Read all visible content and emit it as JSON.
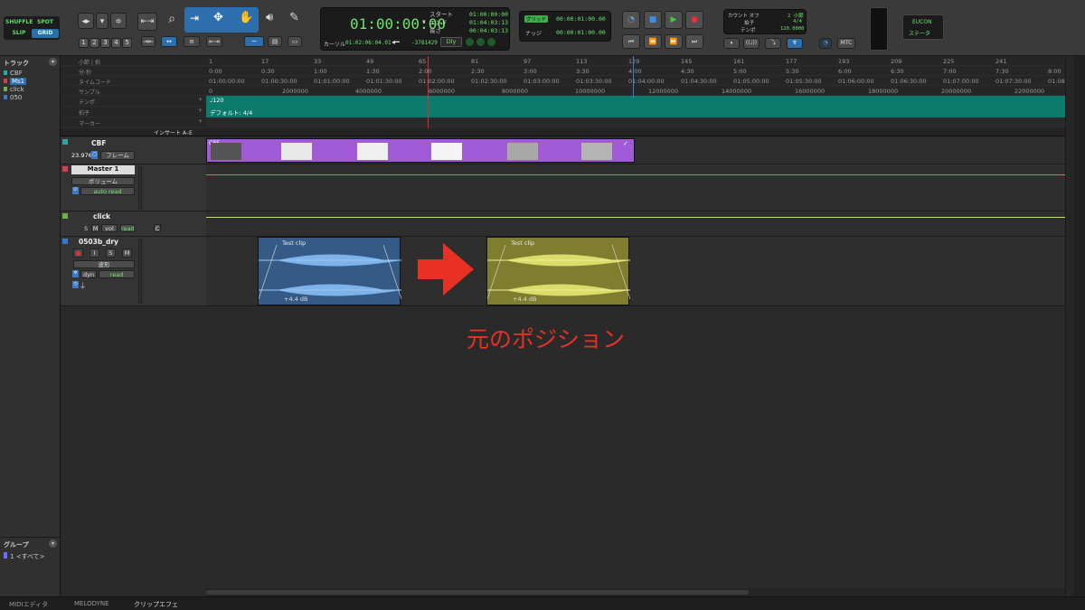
{
  "modes": {
    "shuffle": "SHUFFLE",
    "spot": "SPOT",
    "slip": "SLIP",
    "grid": "GRID"
  },
  "zoom_presets": [
    "1",
    "2",
    "3",
    "4",
    "5"
  ],
  "counter": {
    "main": "01:00:00:00",
    "start_label": "スタート",
    "end_label": "エンド",
    "length_label": "長さ",
    "start": "01:00:00:00",
    "end": "01:04:03:13",
    "length": "00:04:03:13",
    "cursor_label": "カーソル",
    "cursor": "01:02:06:04.01",
    "sample_offset": "-3781429",
    "dly": "Dly"
  },
  "grid": {
    "grid_label": "グリッド",
    "grid_value": "00:00:01:00.00",
    "nudge_label": "ナッジ",
    "nudge_value": "00:00:01:00.00"
  },
  "midi": {
    "count_off": "カウント オフ",
    "bars": "2 小節",
    "meter_label": "拍子",
    "meter": "4/4",
    "tempo_label": "テンポ",
    "tempo": "120.0000"
  },
  "mtc": "MTC",
  "eucon": {
    "title": "EUCON",
    "status": "ステータ"
  },
  "left_panel": {
    "tracks_title": "トラック",
    "tracks": [
      {
        "name": "CBF"
      },
      {
        "name": "Ms1"
      },
      {
        "name": "click"
      },
      {
        "name": "050"
      }
    ],
    "groups_title": "グループ",
    "groups": [
      {
        "id": "1",
        "name": "<すべて>"
      }
    ]
  },
  "rulers": {
    "bars_label": "小節 | 拍",
    "bars": [
      "1",
      "17",
      "33",
      "49",
      "65",
      "81",
      "97",
      "113",
      "129",
      "145",
      "161",
      "177",
      "193",
      "209",
      "225",
      "241"
    ],
    "minsec_label": "分:秒",
    "minsec": [
      "0:00",
      "0:30",
      "1:00",
      "1:30",
      "2:00",
      "2:30",
      "3:00",
      "3:30",
      "4:00",
      "4:30",
      "5:00",
      "5:30",
      "6:00",
      "6:30",
      "7:00",
      "7:30",
      "8:00"
    ],
    "tc_label": "タイムコード",
    "tc": [
      "01:00:00:00",
      "01:00:30:00",
      "01:01:00:00",
      "01:01:30:00",
      "01:02:00:00",
      "01:02:30:00",
      "01:03:00:00",
      "01:03:30:00",
      "01:04:00:00",
      "01:04:30:00",
      "01:05:00:00",
      "01:05:30:00",
      "01:06:00:00",
      "01:06:30:00",
      "01:07:00:00",
      "01:07:30:00",
      "01:08"
    ],
    "samples_label": "サンプル",
    "samples": [
      "0",
      "2000000",
      "4000000",
      "6000000",
      "8000000",
      "10000000",
      "12000000",
      "14000000",
      "16000000",
      "18000000",
      "20000000",
      "22000000"
    ],
    "tempo_label": "テンポ",
    "tempo": "♩120",
    "meter_label": "拍子",
    "meter": "デフォルト: 4/4",
    "markers_label": "マーカー"
  },
  "insert_header": "インサート A–E",
  "tracks": [
    {
      "name": "CBF",
      "fps": "23.976",
      "view": "フレーム"
    },
    {
      "name": "Master 1",
      "view": "ボリューム",
      "automation": "auto read"
    },
    {
      "name": "click",
      "s": "S",
      "m": "M",
      "vol": "vol",
      "read": "read",
      "c": "C"
    },
    {
      "name": "0503b_dry",
      "rec": "●",
      "i": "I",
      "s": "S",
      "m": "M",
      "view": "波形",
      "dyn": "dyn",
      "read": "read"
    }
  ],
  "video_clip_label": "CBF",
  "clips": [
    {
      "name": "Test clip",
      "gain": "+4.4 dB"
    },
    {
      "name": "Test clip",
      "gain": "+4.4 dB"
    }
  ],
  "annotation": "元のポジション",
  "bottom_tabs": [
    "MIDIエディタ",
    "MELODYNE",
    "クリップエフェ"
  ],
  "colors": {
    "lcd_green": "#6ee36e",
    "video_purple": "#a25bd8",
    "clip_blue": "#355a86",
    "clip_yellow": "#7f7d2e",
    "arrow_red": "#e83024",
    "annotation_red": "#e83024",
    "master_line": "#e06a78",
    "click_line": "#b8e06e",
    "tempo_track": "#0c7a6c"
  }
}
